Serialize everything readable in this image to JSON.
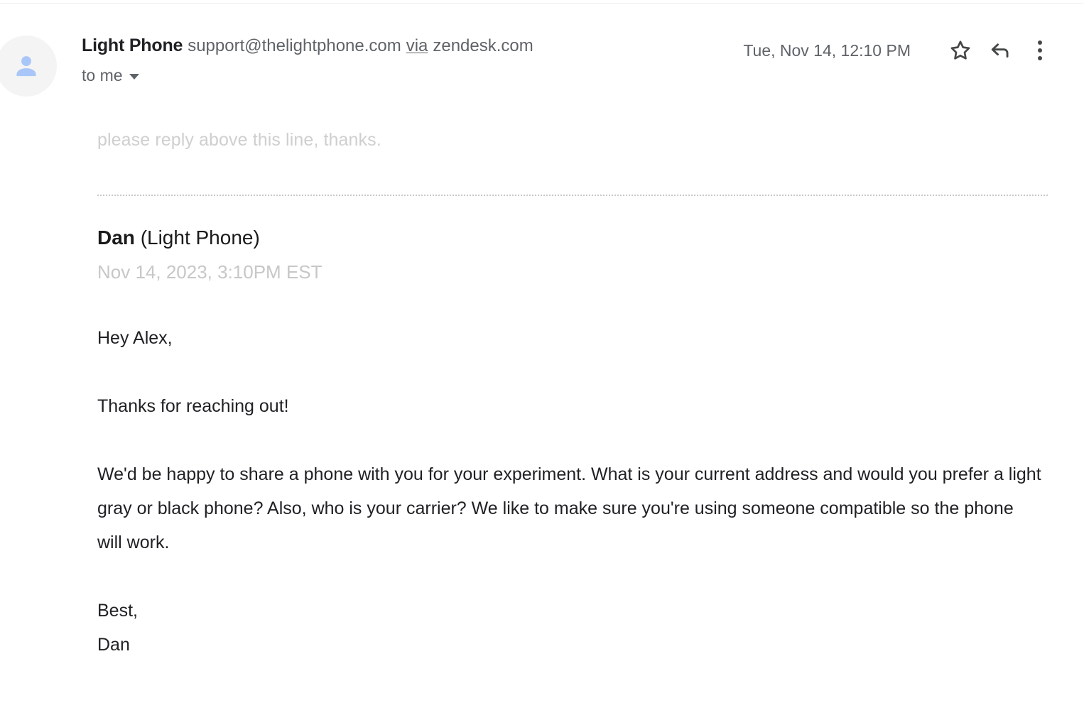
{
  "header": {
    "avatar_icon": "person-avatar-icon",
    "sender_name": "Light Phone",
    "sender_email": "support@thelightphone.com",
    "via_label": "via",
    "via_domain": "zendesk.com",
    "recipient": "to me",
    "recipient_caret_icon": "chevron-down-icon",
    "timestamp": "Tue, Nov 14, 12:10 PM",
    "star_icon": "star-outline-icon",
    "reply_icon": "reply-arrow-icon",
    "more_icon": "more-vertical-icon"
  },
  "body": {
    "reply_above_notice": "please reply above this line, thanks.",
    "agent_name_bold": "Dan",
    "agent_name_org": "(Light Phone)",
    "agent_date": "Nov 14, 2023, 3:10PM EST",
    "greeting": "Hey Alex,",
    "paragraph_1": "Thanks for reaching out!",
    "paragraph_2": "We'd be happy to share a phone with you for your experiment. What is your current address and would you prefer a light gray or black phone? Also, who is your carrier? We like to make sure you're using someone compatible so the phone will work.",
    "signoff": "Best,",
    "signature": "Dan"
  },
  "colors": {
    "text_primary": "#202124",
    "text_secondary": "#5f6368",
    "text_muted": "#c7c7c7",
    "avatar_bg": "#f4f4f5",
    "avatar_fg": "#a9c6f8",
    "divider": "#eceef1"
  }
}
